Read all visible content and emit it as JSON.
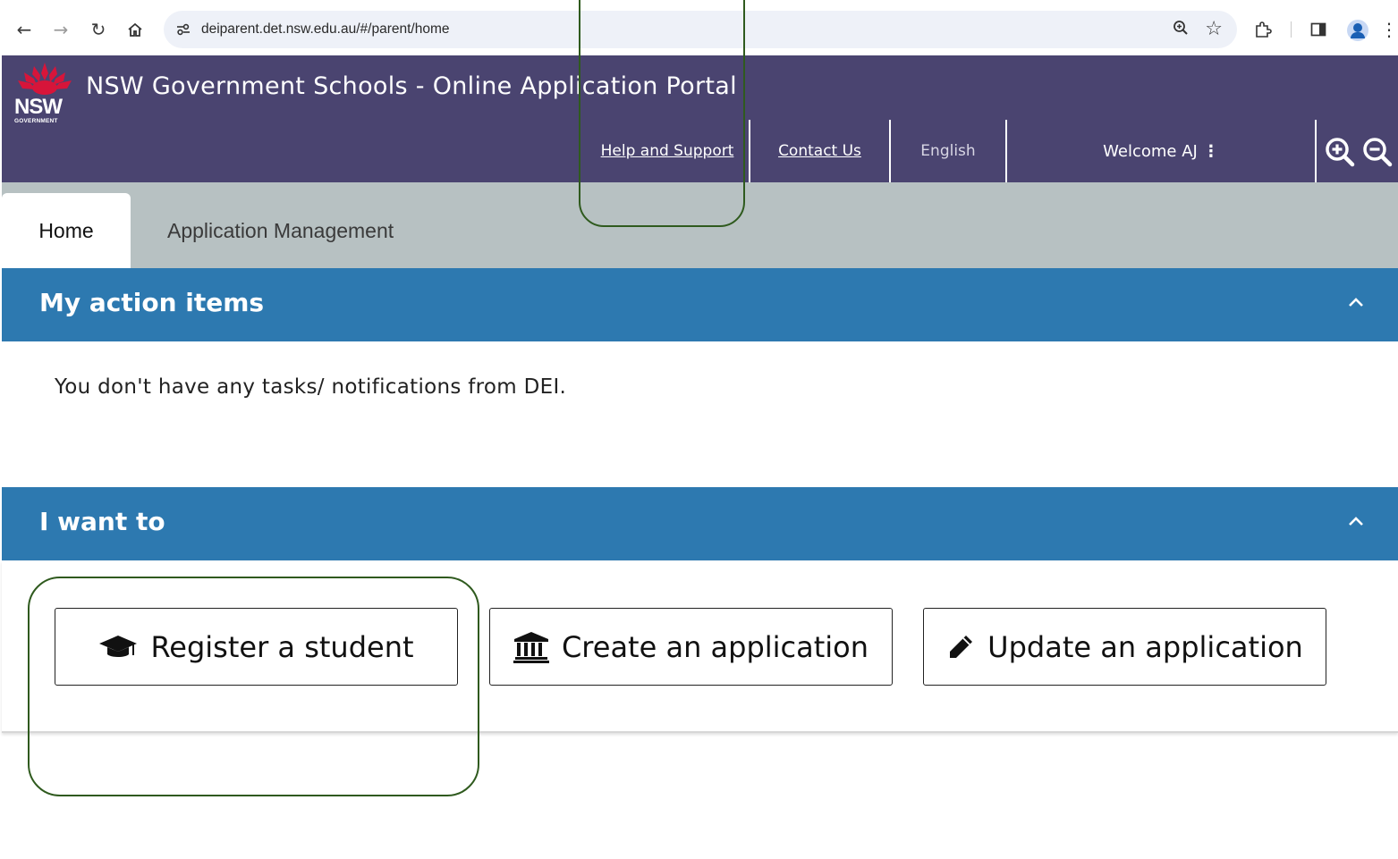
{
  "browser": {
    "url": "deiparent.det.nsw.edu.au/#/parent/home"
  },
  "header": {
    "logo_text": "NSW",
    "logo_sub": "GOVERNMENT",
    "title": "NSW Government Schools - Online Application Portal",
    "nav": {
      "help": "Help and Support",
      "contact": "Contact Us",
      "language": "English",
      "welcome": "Welcome AJ"
    }
  },
  "tabs": [
    {
      "label": "Home",
      "active": true
    },
    {
      "label": "Application Management",
      "active": false
    }
  ],
  "action_items": {
    "title": "My action items",
    "message": "You don't have any tasks/ notifications from DEI."
  },
  "i_want_to": {
    "title": "I want to",
    "buttons": [
      {
        "label": "Register a student",
        "icon": "graduation-cap-icon"
      },
      {
        "label": "Create an application",
        "icon": "institution-icon"
      },
      {
        "label": "Update an application",
        "icon": "pencil-icon"
      }
    ]
  },
  "colors": {
    "header_bg": "#4a4470",
    "tab_bar_bg": "#b7c1c2",
    "panel_bg": "#2d79b0",
    "annotation": "#2f5a1e"
  }
}
